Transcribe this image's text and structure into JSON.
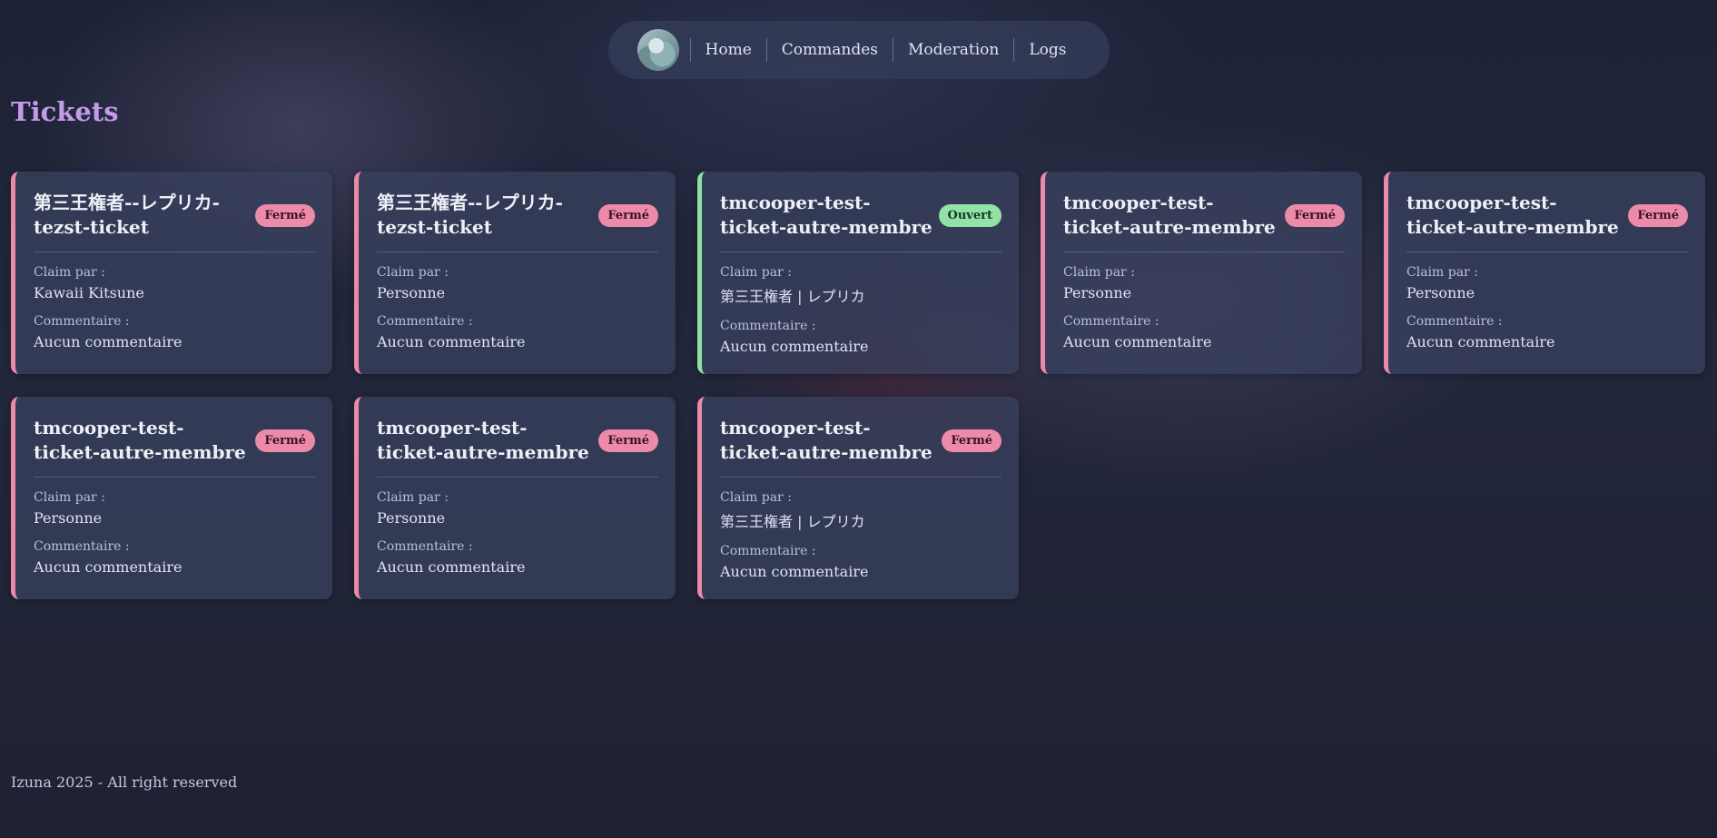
{
  "nav": {
    "links": [
      "Home",
      "Commandes",
      "Moderation",
      "Logs"
    ]
  },
  "page": {
    "title": "Tickets"
  },
  "labels": {
    "claim": "Claim par :",
    "comment": "Commentaire :"
  },
  "tickets": [
    {
      "title": "第三王権者--レプリカ-tezst-ticket",
      "status": "Fermé",
      "claim": "Kawaii Kitsune",
      "comment": "Aucun commentaire"
    },
    {
      "title": "第三王権者--レプリカ-tezst-ticket",
      "status": "Fermé",
      "claim": "Personne",
      "comment": "Aucun commentaire"
    },
    {
      "title": "tmcooper-test-ticket-autre-membre",
      "status": "Ouvert",
      "claim": "第三王権者 | レプリカ",
      "comment": "Aucun commentaire"
    },
    {
      "title": "tmcooper-test-ticket-autre-membre",
      "status": "Fermé",
      "claim": "Personne",
      "comment": "Aucun commentaire"
    },
    {
      "title": "tmcooper-test-ticket-autre-membre",
      "status": "Fermé",
      "claim": "Personne",
      "comment": "Aucun commentaire"
    },
    {
      "title": "tmcooper-test-ticket-autre-membre",
      "status": "Fermé",
      "claim": "Personne",
      "comment": "Aucun commentaire"
    },
    {
      "title": "tmcooper-test-ticket-autre-membre",
      "status": "Fermé",
      "claim": "Personne",
      "comment": "Aucun commentaire"
    },
    {
      "title": "tmcooper-test-ticket-autre-membre",
      "status": "Fermé",
      "claim": "第三王権者 | レプリカ",
      "comment": "Aucun commentaire"
    }
  ],
  "colors": {
    "closed": "#ec8aa9",
    "open": "#92e1a6",
    "title": "#c49bea"
  },
  "footer": {
    "text": "Izuna 2025 - All right reserved"
  }
}
